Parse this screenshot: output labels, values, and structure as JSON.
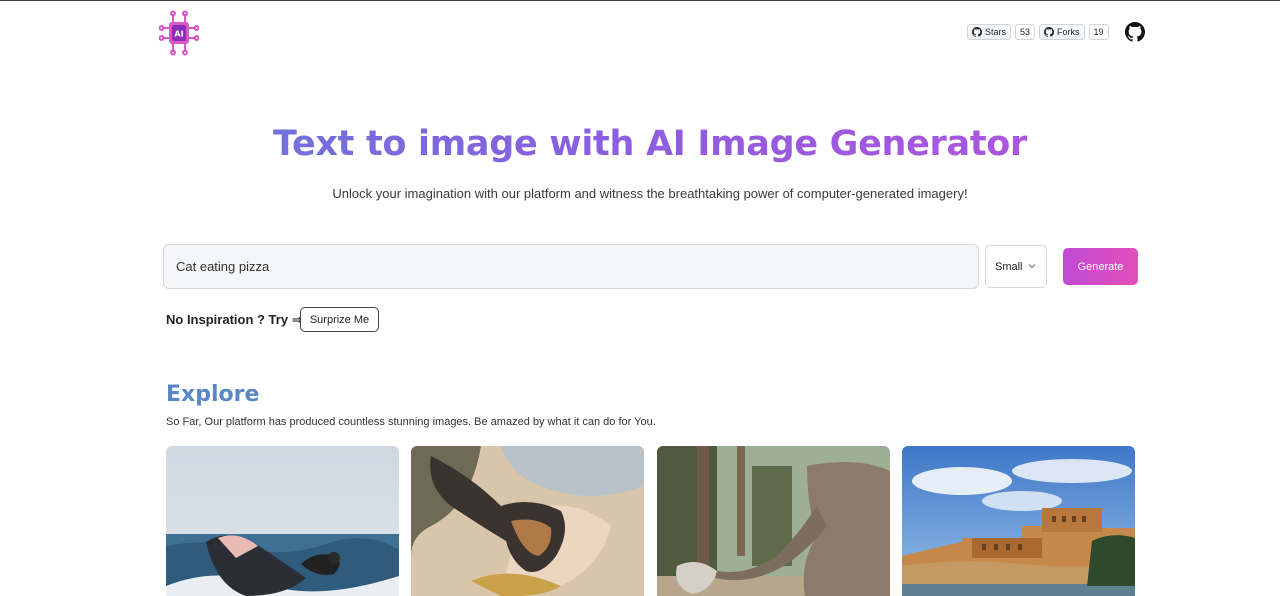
{
  "header": {
    "logo_icon": "ai-chip-icon",
    "stars": {
      "label": "Stars",
      "count": "53"
    },
    "forks": {
      "label": "Forks",
      "count": "19"
    },
    "github_icon": "github-icon"
  },
  "hero": {
    "title": "Text to image with AI Image Generator",
    "subtitle": "Unlock your imagination with our platform and witness the breathtaking power of computer-generated imagery!"
  },
  "form": {
    "prompt_value": "Cat eating pizza",
    "size_selected": "Small",
    "generate_label": "Generate",
    "inspire_text": "No Inspiration ? Try ⇒",
    "surprise_label": "Surprize Me"
  },
  "explore": {
    "title": "Explore",
    "subtitle": "So Far, Our platform has produced countless stunning images. Be amazed by what it can do for You.",
    "images": [
      "whale-and-cat-image",
      "dog-and-lizard-image",
      "elephants-image",
      "fort-palace-image"
    ]
  },
  "colors": {
    "gradient_start": "#5b82d6",
    "gradient_end": "#c04fe0",
    "generate_button": "#c14ad6",
    "explore_title": "#5887c4"
  }
}
